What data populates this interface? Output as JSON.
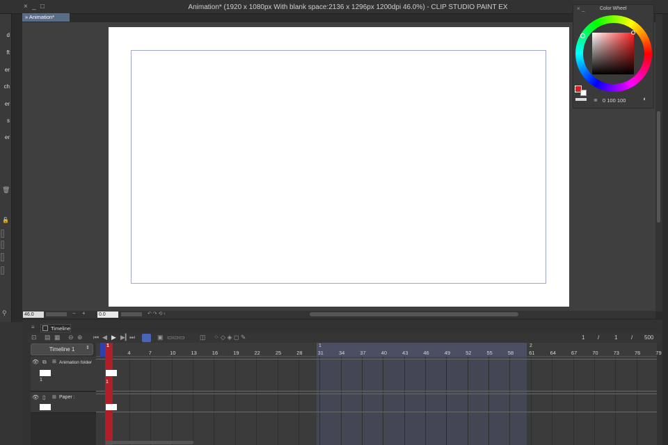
{
  "window": {
    "title": "Animation* (1920 x 1080px With blank space:2136 x 1296px 1200dpi 46.0%)  - CLIP STUDIO PAINT EX",
    "close": "×",
    "minimize": "_",
    "maximize": "□"
  },
  "left_panel": {
    "labels": [
      "d",
      "ft",
      "er",
      "ch",
      "er",
      "s",
      "er"
    ]
  },
  "document_tab": "» Animation*",
  "color_wheel": {
    "title": "Color Wheel",
    "controls": "× _",
    "values": "0  100  100",
    "main_color": "#e21a1a",
    "sub_color": "#ffffff"
  },
  "status_bar": {
    "zoom": "46.0",
    "minus": "−",
    "plus": "+",
    "rotation": "0.0"
  },
  "timeline": {
    "tab_label": "Timeline",
    "selector": "Timeline 1",
    "frame_counter": {
      "current": "1",
      "sep1": "/",
      "total_in_range": "1",
      "sep2": "/",
      "max": "500"
    },
    "playhead_frame": "1",
    "seconds": [
      "1",
      "2"
    ],
    "ticks": [
      "1",
      "4",
      "7",
      "10",
      "13",
      "16",
      "19",
      "22",
      "25",
      "28",
      "31",
      "34",
      "37",
      "40",
      "43",
      "46",
      "49",
      "52",
      "55",
      "58",
      "61",
      "64",
      "67",
      "70",
      "73",
      "76",
      "79"
    ],
    "tracks": [
      {
        "name": "Animation folder",
        "cel_label": "1"
      },
      {
        "name": "Paper :",
        "cel_label": ""
      }
    ],
    "track_cel": "1"
  },
  "colors": {
    "accent": "#2f3fb0",
    "playhead": "#b01e2a",
    "range_highlight": "#4b4f63"
  }
}
